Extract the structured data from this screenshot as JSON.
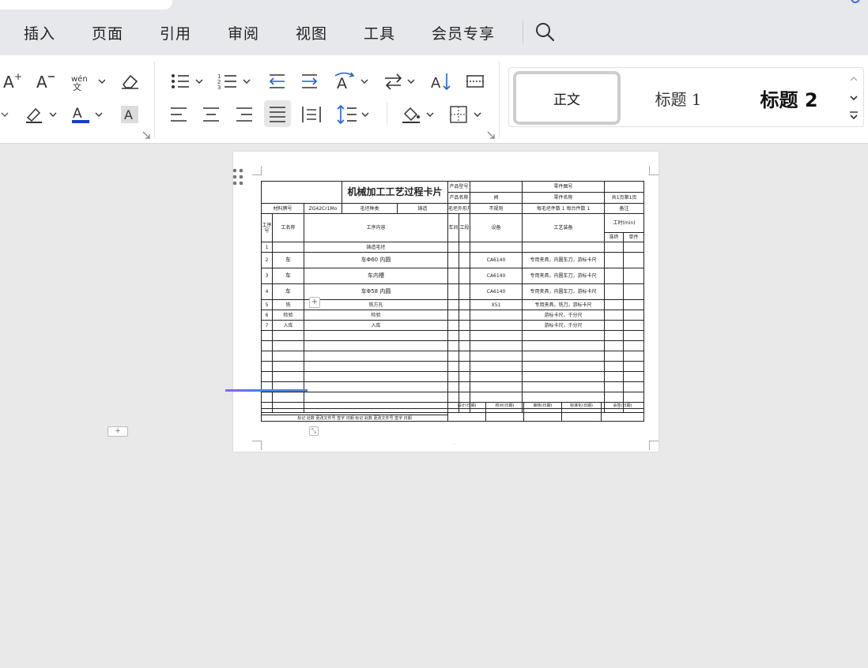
{
  "menu": {
    "items": [
      "插入",
      "页面",
      "引用",
      "审阅",
      "视图",
      "工具",
      "会员专享"
    ]
  },
  "styles": {
    "normal": "正文",
    "heading1": "标题 1",
    "heading2": "标题 2"
  },
  "font_color": "#1a3ccf",
  "card": {
    "title": "机械加工工艺过程卡片",
    "product_model_label": "产品型号",
    "part_drawing_label": "零件图号",
    "product_name_label": "产品名称",
    "product_name_value": "阀",
    "part_name_label": "零件名称",
    "part_name_value": "阀",
    "qty1": "共",
    "qty1_v": "1",
    "qty2": "页",
    "qty3": "第",
    "qty3_v": "1",
    "qty4": "页",
    "material_label": "材料牌号",
    "material_value": "ZG42Cr1Mo",
    "blank_type_label": "毛坯种类",
    "blank_type_value": "铸造",
    "blank_size_label": "毛坯外形尺寸",
    "blank_size_value": "不规则",
    "per_blank_label": "每毛坯件数",
    "per_blank_value": "1",
    "per_unit_label": "每台件数",
    "per_unit_value": "1",
    "remark_label": "备注",
    "h_op_no": "工序号",
    "h_op_name": "工名称",
    "h_content": "工序内容",
    "h_workshop": "车间",
    "h_section": "工段",
    "h_equipment": "设备",
    "h_tooling": "工艺装备",
    "h_hours": "工时(min)",
    "h_prep": "准终",
    "h_unit": "单件",
    "rows": [
      {
        "no": "1",
        "name": "",
        "content": "铸造毛坯",
        "equip": "",
        "tool": ""
      },
      {
        "no": "2",
        "name": "车",
        "content": "车Φ60 内圆",
        "equip": "CA6140",
        "tool": "专用夹具，内圆车刀，游标卡尺"
      },
      {
        "no": "3",
        "name": "车",
        "content": "车内槽",
        "equip": "CA6140",
        "tool": "专用夹具，内圆车刀，游标卡尺"
      },
      {
        "no": "4",
        "name": "车",
        "content": "车Φ58 内圆",
        "equip": "CA6140",
        "tool": "专用夹具，内圆车刀，游标卡尺"
      },
      {
        "no": "5",
        "name": "铣",
        "content": "铣方孔",
        "equip": "X51",
        "tool": "专用夹具，铣刀，游标卡尺"
      },
      {
        "no": "6",
        "name": "检验",
        "content": "检验",
        "equip": "",
        "tool": "游标卡尺，千分尺"
      },
      {
        "no": "7",
        "name": "入库",
        "content": "入库",
        "equip": "",
        "tool": "游标卡尺，千分尺"
      }
    ],
    "sign_design": "设计(日期)",
    "sign_check": "校对(日期)",
    "sign_review": "审核(日期)",
    "sign_standard": "标准化(日期)",
    "sign_countersign": "会签(日期)",
    "sign_mark": "标记",
    "sign_count": "处数",
    "sign_doc": "更改文件号",
    "sign_sig": "签字",
    "sign_date": "日期"
  }
}
